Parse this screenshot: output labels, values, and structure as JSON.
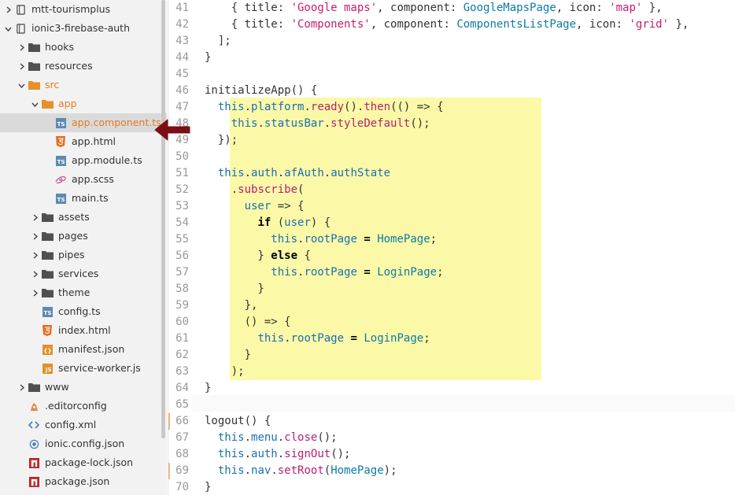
{
  "sidebar": {
    "rows": [
      {
        "label": "mtt-tourismplus",
        "icon": "repo-icon",
        "chevron": "right",
        "indent": 0
      },
      {
        "label": "ionic3-firebase-auth",
        "icon": "repo-icon",
        "chevron": "down",
        "indent": 0
      },
      {
        "label": "hooks",
        "icon": "folder-icon",
        "chevron": "right",
        "indent": 1
      },
      {
        "label": "resources",
        "icon": "folder-icon",
        "chevron": "right",
        "indent": 1
      },
      {
        "label": "src",
        "icon": "folder-open-icon",
        "chevron": "down",
        "indent": 1,
        "accent": true
      },
      {
        "label": "app",
        "icon": "folder-open-icon",
        "chevron": "down",
        "indent": 2,
        "accent": true
      },
      {
        "label": "app.component.ts",
        "icon": "ts-file-icon",
        "chevron": "",
        "indent": 3,
        "selected": true
      },
      {
        "label": "app.html",
        "icon": "html-file-icon",
        "chevron": "",
        "indent": 3
      },
      {
        "label": "app.module.ts",
        "icon": "ts-file-icon",
        "chevron": "",
        "indent": 3
      },
      {
        "label": "app.scss",
        "icon": "sass-file-icon",
        "chevron": "",
        "indent": 3
      },
      {
        "label": "main.ts",
        "icon": "ts-file-icon",
        "chevron": "",
        "indent": 3
      },
      {
        "label": "assets",
        "icon": "folder-icon",
        "chevron": "right",
        "indent": 2
      },
      {
        "label": "pages",
        "icon": "folder-icon",
        "chevron": "right",
        "indent": 2
      },
      {
        "label": "pipes",
        "icon": "folder-icon",
        "chevron": "right",
        "indent": 2
      },
      {
        "label": "services",
        "icon": "folder-icon",
        "chevron": "right",
        "indent": 2
      },
      {
        "label": "theme",
        "icon": "folder-icon",
        "chevron": "right",
        "indent": 2
      },
      {
        "label": "config.ts",
        "icon": "ts-file-icon",
        "chevron": "",
        "indent": 2
      },
      {
        "label": "index.html",
        "icon": "html-file-icon",
        "chevron": "",
        "indent": 2
      },
      {
        "label": "manifest.json",
        "icon": "json-file-icon",
        "chevron": "",
        "indent": 2
      },
      {
        "label": "service-worker.js",
        "icon": "js-file-icon",
        "chevron": "",
        "indent": 2
      },
      {
        "label": "www",
        "icon": "folder-icon",
        "chevron": "right",
        "indent": 1
      },
      {
        "label": ".editorconfig",
        "icon": "editorconfig-file-icon",
        "chevron": "",
        "indent": 1
      },
      {
        "label": "config.xml",
        "icon": "xml-file-icon",
        "chevron": "",
        "indent": 1
      },
      {
        "label": "ionic.config.json",
        "icon": "ionic-file-icon",
        "chevron": "",
        "indent": 1
      },
      {
        "label": "package-lock.json",
        "icon": "npm-file-icon",
        "chevron": "",
        "indent": 1
      },
      {
        "label": "package.json",
        "icon": "npm-file-icon",
        "chevron": "",
        "indent": 1
      }
    ]
  },
  "colors": {
    "accent": "#e57c1f",
    "selection_bg": "#dadada",
    "code_highlight": "#fbf9a7",
    "arrow": "#7a0f14",
    "string": "#c91b6a",
    "type": "#0c7aa6",
    "this": "#1a6fb4",
    "method": "#b52072"
  },
  "editor": {
    "modified_line_markers": [
      66,
      69
    ],
    "current_line": 65,
    "lines": [
      {
        "n": "41",
        "tokens": [
          [
            "    { title: ",
            "plain"
          ],
          [
            "'Google maps'",
            "str"
          ],
          [
            ", component: ",
            "plain"
          ],
          [
            "GoogleMapsPage",
            "type"
          ],
          [
            ", icon: ",
            "plain"
          ],
          [
            "'map'",
            "str"
          ],
          [
            " },",
            "plain"
          ]
        ]
      },
      {
        "n": "42",
        "tokens": [
          [
            "    { title: ",
            "plain"
          ],
          [
            "'Components'",
            "str"
          ],
          [
            ", component: ",
            "plain"
          ],
          [
            "ComponentsListPage",
            "type"
          ],
          [
            ", icon: ",
            "plain"
          ],
          [
            "'grid'",
            "str"
          ],
          [
            " },",
            "plain"
          ]
        ]
      },
      {
        "n": "43",
        "tokens": [
          [
            "  ];",
            "plain"
          ]
        ]
      },
      {
        "n": "44",
        "tokens": [
          [
            "}",
            "plain"
          ]
        ]
      },
      {
        "n": "45",
        "tokens": []
      },
      {
        "n": "46",
        "tokens": [
          [
            "initializeApp() {",
            "plain"
          ]
        ]
      },
      {
        "n": "47",
        "tokens": [
          [
            "  ",
            "plain"
          ],
          [
            "this",
            "this"
          ],
          [
            ".",
            "plain"
          ],
          [
            "platform",
            "this"
          ],
          [
            ".",
            "plain"
          ],
          [
            "ready",
            "fn"
          ],
          [
            "().",
            "plain"
          ],
          [
            "then",
            "fn"
          ],
          [
            "(() => {",
            "plain"
          ]
        ]
      },
      {
        "n": "48",
        "tokens": [
          [
            "    ",
            "plain"
          ],
          [
            "this",
            "this"
          ],
          [
            ".",
            "plain"
          ],
          [
            "statusBar",
            "this"
          ],
          [
            ".",
            "plain"
          ],
          [
            "styleDefault",
            "fn"
          ],
          [
            "();",
            "plain"
          ]
        ]
      },
      {
        "n": "49",
        "tokens": [
          [
            "  });",
            "plain"
          ]
        ]
      },
      {
        "n": "50",
        "tokens": []
      },
      {
        "n": "51",
        "tokens": [
          [
            "  ",
            "plain"
          ],
          [
            "this",
            "this"
          ],
          [
            ".",
            "plain"
          ],
          [
            "auth",
            "this"
          ],
          [
            ".",
            "plain"
          ],
          [
            "afAuth",
            "this"
          ],
          [
            ".",
            "plain"
          ],
          [
            "authState",
            "this"
          ]
        ]
      },
      {
        "n": "52",
        "tokens": [
          [
            "    .",
            "plain"
          ],
          [
            "subscribe",
            "fn"
          ],
          [
            "(",
            "plain"
          ]
        ]
      },
      {
        "n": "53",
        "tokens": [
          [
            "      ",
            "plain"
          ],
          [
            "user",
            "this"
          ],
          [
            " => {",
            "plain"
          ]
        ]
      },
      {
        "n": "54",
        "tokens": [
          [
            "        ",
            "plain"
          ],
          [
            "if",
            "kw"
          ],
          [
            " (",
            "plain"
          ],
          [
            "user",
            "this"
          ],
          [
            ") {",
            "plain"
          ]
        ]
      },
      {
        "n": "55",
        "tokens": [
          [
            "          ",
            "plain"
          ],
          [
            "this",
            "this"
          ],
          [
            ".",
            "plain"
          ],
          [
            "rootPage",
            "this"
          ],
          [
            " ",
            "plain"
          ],
          [
            "=",
            "kw"
          ],
          [
            " ",
            "plain"
          ],
          [
            "HomePage",
            "type"
          ],
          [
            ";",
            "plain"
          ]
        ]
      },
      {
        "n": "56",
        "tokens": [
          [
            "        } ",
            "plain"
          ],
          [
            "else",
            "kw"
          ],
          [
            " {",
            "plain"
          ]
        ]
      },
      {
        "n": "57",
        "tokens": [
          [
            "          ",
            "plain"
          ],
          [
            "this",
            "this"
          ],
          [
            ".",
            "plain"
          ],
          [
            "rootPage",
            "this"
          ],
          [
            " ",
            "plain"
          ],
          [
            "=",
            "kw"
          ],
          [
            " ",
            "plain"
          ],
          [
            "LoginPage",
            "type"
          ],
          [
            ";",
            "plain"
          ]
        ]
      },
      {
        "n": "58",
        "tokens": [
          [
            "        }",
            "plain"
          ]
        ]
      },
      {
        "n": "59",
        "tokens": [
          [
            "      },",
            "plain"
          ]
        ]
      },
      {
        "n": "60",
        "tokens": [
          [
            "      () => {",
            "plain"
          ]
        ]
      },
      {
        "n": "61",
        "tokens": [
          [
            "        ",
            "plain"
          ],
          [
            "this",
            "this"
          ],
          [
            ".",
            "plain"
          ],
          [
            "rootPage",
            "this"
          ],
          [
            " ",
            "plain"
          ],
          [
            "=",
            "kw"
          ],
          [
            " ",
            "plain"
          ],
          [
            "LoginPage",
            "type"
          ],
          [
            ";",
            "plain"
          ]
        ]
      },
      {
        "n": "62",
        "tokens": [
          [
            "      }",
            "plain"
          ]
        ]
      },
      {
        "n": "63",
        "tokens": [
          [
            "    );",
            "plain"
          ]
        ]
      },
      {
        "n": "64",
        "tokens": [
          [
            "}",
            "plain"
          ]
        ]
      },
      {
        "n": "65",
        "tokens": []
      },
      {
        "n": "66",
        "tokens": [
          [
            "logout() {",
            "plain"
          ]
        ]
      },
      {
        "n": "67",
        "tokens": [
          [
            "  ",
            "plain"
          ],
          [
            "this",
            "this"
          ],
          [
            ".",
            "plain"
          ],
          [
            "menu",
            "this"
          ],
          [
            ".",
            "plain"
          ],
          [
            "close",
            "fn"
          ],
          [
            "();",
            "plain"
          ]
        ]
      },
      {
        "n": "68",
        "tokens": [
          [
            "  ",
            "plain"
          ],
          [
            "this",
            "this"
          ],
          [
            ".",
            "plain"
          ],
          [
            "auth",
            "this"
          ],
          [
            ".",
            "plain"
          ],
          [
            "signOut",
            "fn"
          ],
          [
            "();",
            "plain"
          ]
        ]
      },
      {
        "n": "69",
        "tokens": [
          [
            "  ",
            "plain"
          ],
          [
            "this",
            "this"
          ],
          [
            ".",
            "plain"
          ],
          [
            "nav",
            "this"
          ],
          [
            ".",
            "plain"
          ],
          [
            "setRoot",
            "fn"
          ],
          [
            "(",
            "plain"
          ],
          [
            "HomePage",
            "type"
          ],
          [
            ");",
            "plain"
          ]
        ]
      },
      {
        "n": "70",
        "tokens": [
          [
            "}",
            "plain"
          ]
        ]
      }
    ]
  }
}
